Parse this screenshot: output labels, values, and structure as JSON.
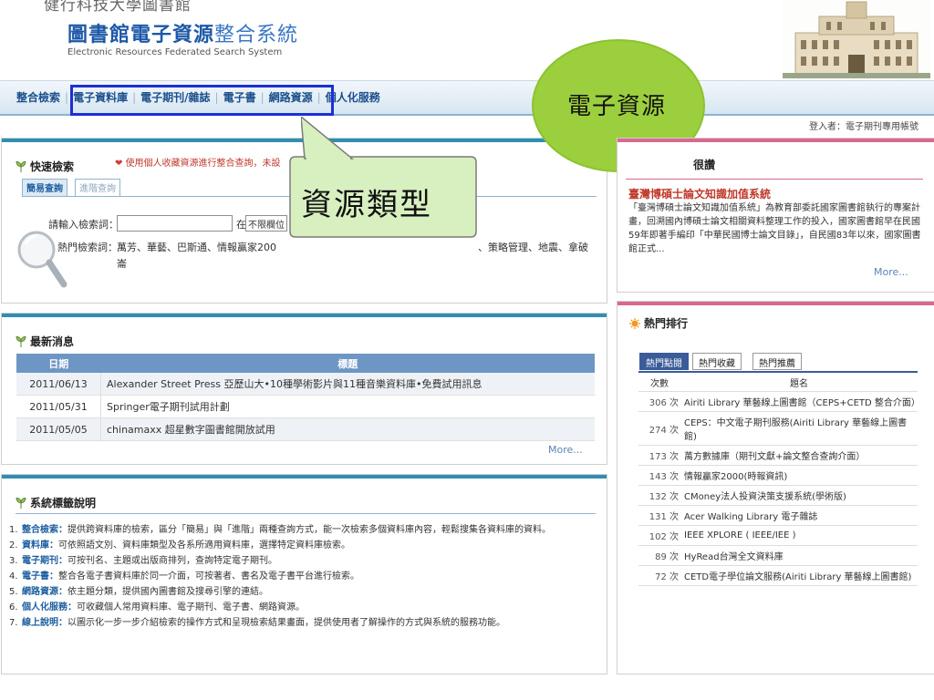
{
  "header": {
    "university": "健行科技大學圖書館",
    "title_bold": "圖書館電子資源",
    "title_light": "整合系統",
    "subtitle": "Electronic Resources Federated Search System"
  },
  "nav": {
    "items": [
      "整合檢索",
      "電子資料庫",
      "電子期刊/雜誌",
      "電子書",
      "網路資源",
      "個人化服務"
    ]
  },
  "login_text": "登入者：電子期刊專用帳號",
  "callouts": {
    "resource_type": "資源類型",
    "electronic_resources": "電子資源"
  },
  "quick_search": {
    "title": "快速檢索",
    "hint": "使用個人收藏資源進行整合查詢，未設",
    "tab_simple": "簡易查詢",
    "tab_advanced": "進階查詢",
    "keyword_label": "請輸入檢索詞：",
    "keyword_value": "",
    "in_label": "在",
    "field_value": "不限欄位",
    "hot_label": "熱門檢索詞：",
    "hot_terms_1": "萬芳、華藝、巴斯通、情報贏家200",
    "hot_terms_2": "、策略管理、地震、拿破",
    "hot_terms_3": "崙"
  },
  "news": {
    "title": "最新消息",
    "col_date": "日期",
    "col_title": "標題",
    "rows": [
      {
        "date": "2011/06/13",
        "title": "Alexander Street Press 亞歷山大•10種學術影片與11種音樂資料庫•免費試用訊息"
      },
      {
        "date": "2011/05/31",
        "title": "Springer電子期刊試用計劃"
      },
      {
        "date": "2011/05/05",
        "title": "chinamaxx 超星數字圖書館開放試用"
      }
    ],
    "more": "More..."
  },
  "help": {
    "title": "系統標籤說明",
    "items": [
      {
        "num": "1.",
        "term": "整合檢索：",
        "text": "提供跨資料庫的檢索，區分「簡易」與「進階」兩種查詢方式，能一次檢索多個資料庫內容，輕鬆搜集各資料庫的資料。"
      },
      {
        "num": "2.",
        "term": "資料庫：",
        "text": "可依照語文別、資料庫類型及各系所適用資料庫，選擇特定資料庫檢索。"
      },
      {
        "num": "3.",
        "term": "電子期刊：",
        "text": "可按刊名、主題或出版商排列，查詢特定電子期刊。"
      },
      {
        "num": "4.",
        "term": "電子書：",
        "text": "整合各電子書資料庫於同一介面，可按著者、書名及電子書平台進行檢索。"
      },
      {
        "num": "5.",
        "term": "網路資源：",
        "text": "依主題分類，提供國內圖書館及搜尋引擎的連結。"
      },
      {
        "num": "6.",
        "term": "個人化服務：",
        "text": "可收藏個人常用資料庫、電子期刊、電子書、網路資源。"
      },
      {
        "num": "7.",
        "term": "線上說明：",
        "text": "以圖示化一步一步介紹檢索的操作方式和呈現檢索結果畫面，提供使用者了解操作的方式與系統的服務功能。"
      }
    ]
  },
  "recommend": {
    "title": "很讚",
    "link": "臺灣博碩士論文知識加值系統",
    "desc": "「臺灣博碩士論文知識加值系統」為教育部委託國家圖書館執行的專案計畫，回溯國內博碩士論文相關資料整理工作的投入，國家圖書館早在民國59年即著手編印「中華民國博士論文目錄」，自民國83年以來，國家圖書館正式...",
    "more": "More..."
  },
  "hot": {
    "title": "熱門排行",
    "tabs": [
      "熱門點閱",
      "熱門收藏",
      "熱門推薦"
    ],
    "col_count": "次數",
    "col_name": "題名",
    "rows": [
      {
        "count": "306 次",
        "name": "Airiti Library 華藝線上圖書館（CEPS+CETD 整合介面）"
      },
      {
        "count": "274 次",
        "name": "CEPS：中文電子期刊服務(Airiti Library 華藝線上圖書館)"
      },
      {
        "count": "173 次",
        "name": "萬方數據庫（期刊文獻+論文整合查詢介面）"
      },
      {
        "count": "143 次",
        "name": "情報贏家2000(時報資訊)"
      },
      {
        "count": "132 次",
        "name": "CMoney法人投資決策支援系統(學術版)"
      },
      {
        "count": "131 次",
        "name": "Acer Walking Library 電子雜誌"
      },
      {
        "count": "102 次",
        "name": "IEEE XPLORE ( IEEE/IEE )"
      },
      {
        "count": "89 次",
        "name": "HyRead台灣全文資料庫"
      },
      {
        "count": "72 次",
        "name": "CETD電子學位論文服務(Airiti Library 華藝線上圖書館)"
      }
    ]
  },
  "colors": {
    "brand_blue": "#1d58a8",
    "nav_text": "#1b4f8c",
    "highlight_box": "#1b2fd6",
    "callout_green": "#9ccf3e",
    "hot_accent": "#d8698d"
  }
}
